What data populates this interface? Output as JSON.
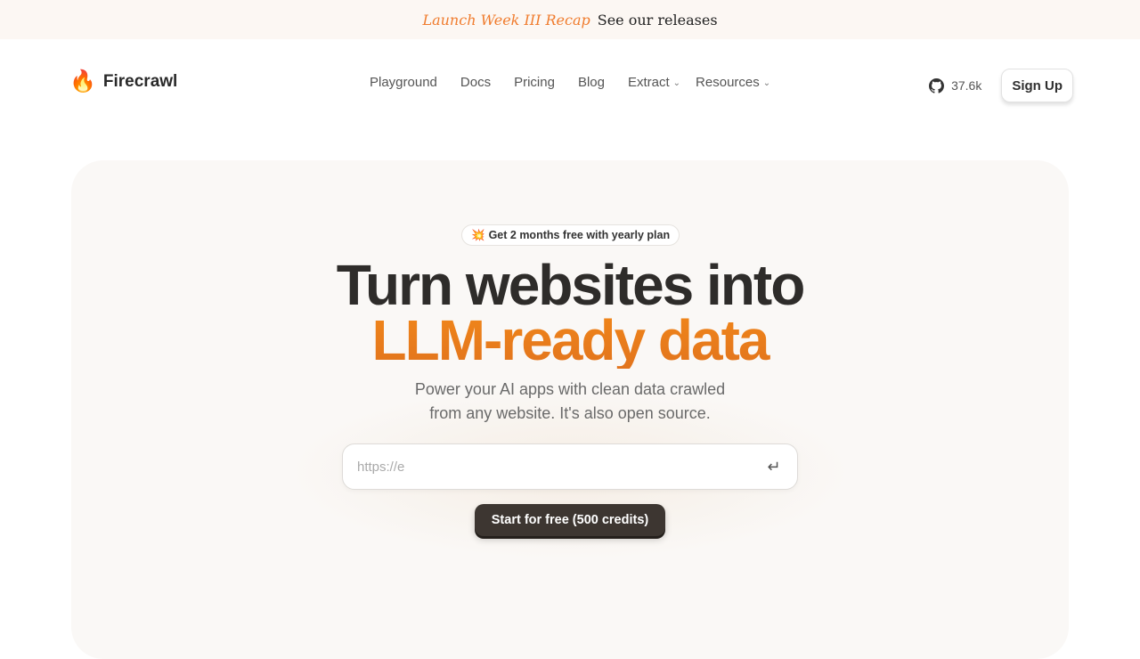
{
  "announcement": {
    "recap": "Launch Week III Recap",
    "link": "See our releases"
  },
  "logo": {
    "icon": "fire-emoji",
    "text": "Firecrawl"
  },
  "nav": {
    "links": [
      "Playground",
      "Docs",
      "Pricing",
      "Blog"
    ],
    "extract": "Extract",
    "resources": "Resources",
    "github_stars": "37.6k",
    "signup": "Sign Up"
  },
  "hero": {
    "badge_icon": "💥",
    "badge": "Get 2 months free with yearly plan",
    "title_line1": "Turn websites into",
    "title_line2": "LLM-ready data",
    "subtitle_line1": "Power your AI apps with clean data crawled",
    "subtitle_line2": "from any website. It's also open source.",
    "url_placeholder": "https://e",
    "cta": "Start for free (500 credits)"
  },
  "colors": {
    "accent": "#ed7d1c",
    "banner_bg": "#fcf7f3",
    "hero_bg": "#faf8f6",
    "cta_bg": "#3d3631"
  }
}
